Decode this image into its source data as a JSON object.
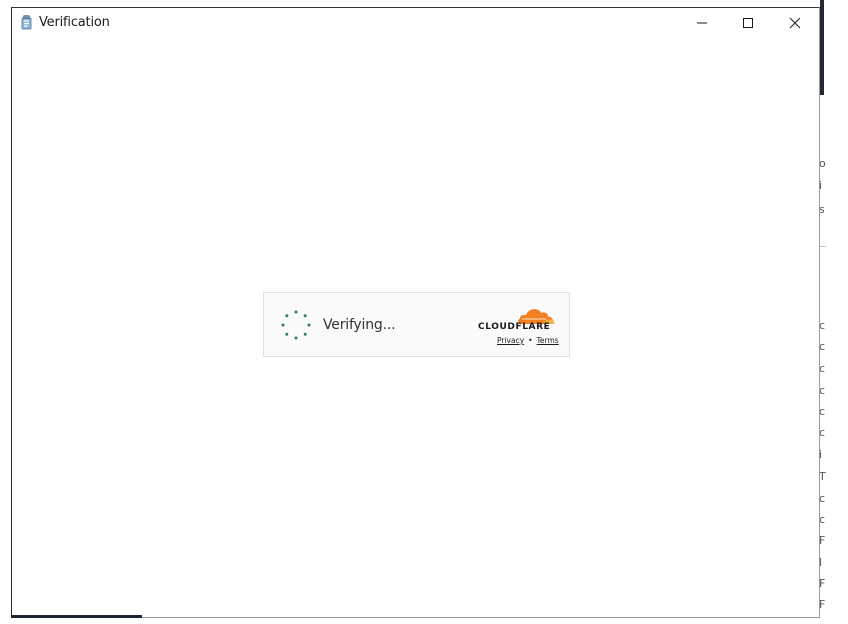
{
  "window": {
    "title": "Verification",
    "controls": {
      "minimize": "minimize-icon",
      "maximize": "maximize-icon",
      "close": "close-icon"
    }
  },
  "widget": {
    "status_text": "Verifying...",
    "brand": "CLOUDFLARE",
    "links": {
      "privacy": "Privacy",
      "separator": "•",
      "terms": "Terms"
    },
    "colors": {
      "spinner": "#2e7d4f",
      "cloud_main": "#f38020",
      "cloud_light": "#faae40"
    }
  },
  "background": {
    "edge_glyphs": [
      "o",
      "i",
      "s",
      "c",
      "c",
      "c",
      "c",
      "c",
      "c",
      "i",
      "T",
      "c",
      "c",
      "F",
      "l",
      "F",
      "F"
    ]
  }
}
